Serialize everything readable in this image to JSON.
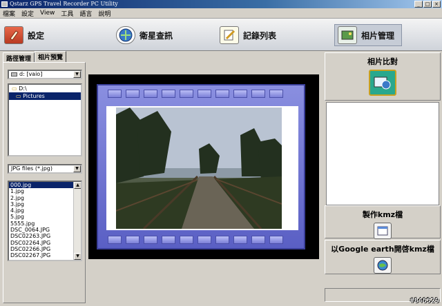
{
  "window": {
    "title": "Qstarz GPS Travel Recorder PC Utility"
  },
  "menu": [
    "檔案",
    "設定",
    "View",
    "工具",
    "語言",
    "說明"
  ],
  "toolbar": {
    "settings_label": "設定",
    "satellite_label": "衛星查訊",
    "records_label": "記錄列表",
    "photos_label": "相片管理"
  },
  "tabs": [
    "路徑管理",
    "相片預覽"
  ],
  "drive": {
    "selected": "d: [vaio]"
  },
  "folders": [
    "D:\\",
    "Pictures"
  ],
  "file_filter": {
    "selected": "JPG files (*.jpg)"
  },
  "files": [
    "000.jpg",
    "1.jpg",
    "2.jpg",
    "3.jpg",
    "4.jpg",
    "5.jpg",
    "5555.jpg",
    "DSC_0064.JPG",
    "DSC02263.JPG",
    "DSC02264.JPG",
    "DSC02266.JPG",
    "DSC02267.JPG"
  ],
  "right_panel": {
    "compare_label": "相片比對",
    "make_kmz_label": "製作kmz檔",
    "open_kmz_label": "以Google earth開啓kmz檔"
  },
  "watermark": "#846529",
  "colors": {
    "selection": "#0a246a",
    "film": "#6b70d4",
    "titlebar": "#0a246a"
  }
}
